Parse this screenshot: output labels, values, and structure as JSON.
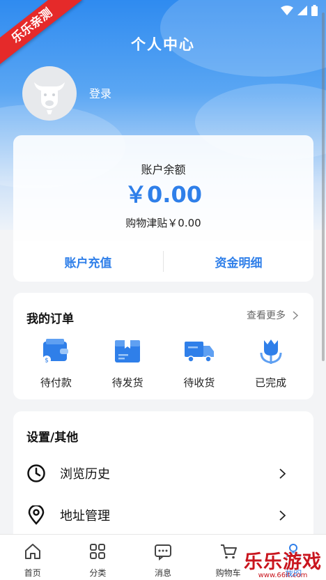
{
  "colors": {
    "accent": "#2f7fe9",
    "hero_top": "#2f8bf0",
    "ribbon": "#e52a2a",
    "watermark": "#c9151e"
  },
  "badge": {
    "ribbon_text": "乐乐亲测"
  },
  "header": {
    "title": "个人中心",
    "login_label": "登录"
  },
  "balance": {
    "label": "账户余额",
    "amount": "￥0.00",
    "subsidy": "购物津贴￥0.00",
    "recharge_label": "账户充值",
    "details_label": "资金明细"
  },
  "orders": {
    "title": "我的订单",
    "see_more": "查看更多",
    "items": [
      {
        "label": "待付款",
        "icon": "wallet-icon"
      },
      {
        "label": "待发货",
        "icon": "package-icon"
      },
      {
        "label": "待收货",
        "icon": "truck-icon"
      },
      {
        "label": "已完成",
        "icon": "flower-icon"
      }
    ]
  },
  "settings": {
    "title": "设置/其他",
    "items": [
      {
        "label": "浏览历史",
        "icon": "clock-icon"
      },
      {
        "label": "地址管理",
        "icon": "location-pin-icon"
      }
    ]
  },
  "tabbar": {
    "items": [
      {
        "label": "首页",
        "icon": "home-icon"
      },
      {
        "label": "分类",
        "icon": "grid-icon"
      },
      {
        "label": "消息",
        "icon": "message-icon"
      },
      {
        "label": "购物车",
        "icon": "cart-icon"
      },
      {
        "label": "我的",
        "icon": "user-icon"
      }
    ]
  },
  "watermark": {
    "text": "乐乐游戏",
    "url": "www.66it.com"
  }
}
